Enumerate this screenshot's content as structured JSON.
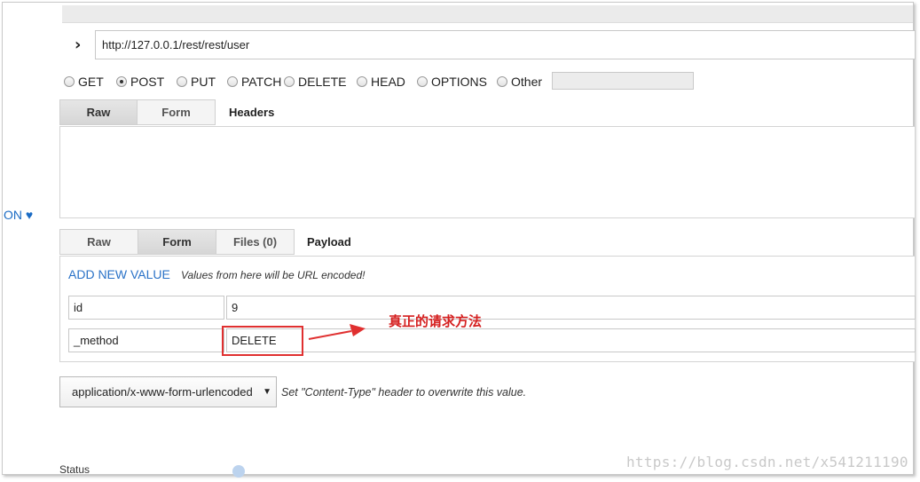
{
  "side_link": "ON ♥",
  "url": {
    "chevron_glyph": "›",
    "value": "http://127.0.0.1/rest/rest/user"
  },
  "methods": [
    {
      "label": "GET",
      "selected": false
    },
    {
      "label": "POST",
      "selected": true
    },
    {
      "label": "PUT",
      "selected": false
    },
    {
      "label": "PATCH",
      "selected": false
    },
    {
      "label": "DELETE",
      "selected": false
    },
    {
      "label": "HEAD",
      "selected": false
    },
    {
      "label": "OPTIONS",
      "selected": false
    },
    {
      "label": "Other",
      "selected": false
    }
  ],
  "headers_tabs": {
    "raw": "Raw",
    "form": "Form",
    "active": "Raw",
    "title": "Headers"
  },
  "payload_tabs": {
    "raw": "Raw",
    "form": "Form",
    "files": "Files (0)",
    "active": "Form",
    "title": "Payload"
  },
  "payload": {
    "add_new": "ADD NEW VALUE",
    "note": "Values from here will be URL encoded!",
    "rows": [
      {
        "key": "id",
        "value": "9"
      },
      {
        "key": "_method",
        "value": "DELETE"
      }
    ]
  },
  "annotation": {
    "text": "真正的请求方法",
    "color": "#d52020"
  },
  "content_type": {
    "selected": "application/x-www-form-urlencoded",
    "note": "Set \"Content-Type\" header to overwrite this value."
  },
  "status_label": "Status",
  "watermark": "https://blog.csdn.net/x541211190"
}
